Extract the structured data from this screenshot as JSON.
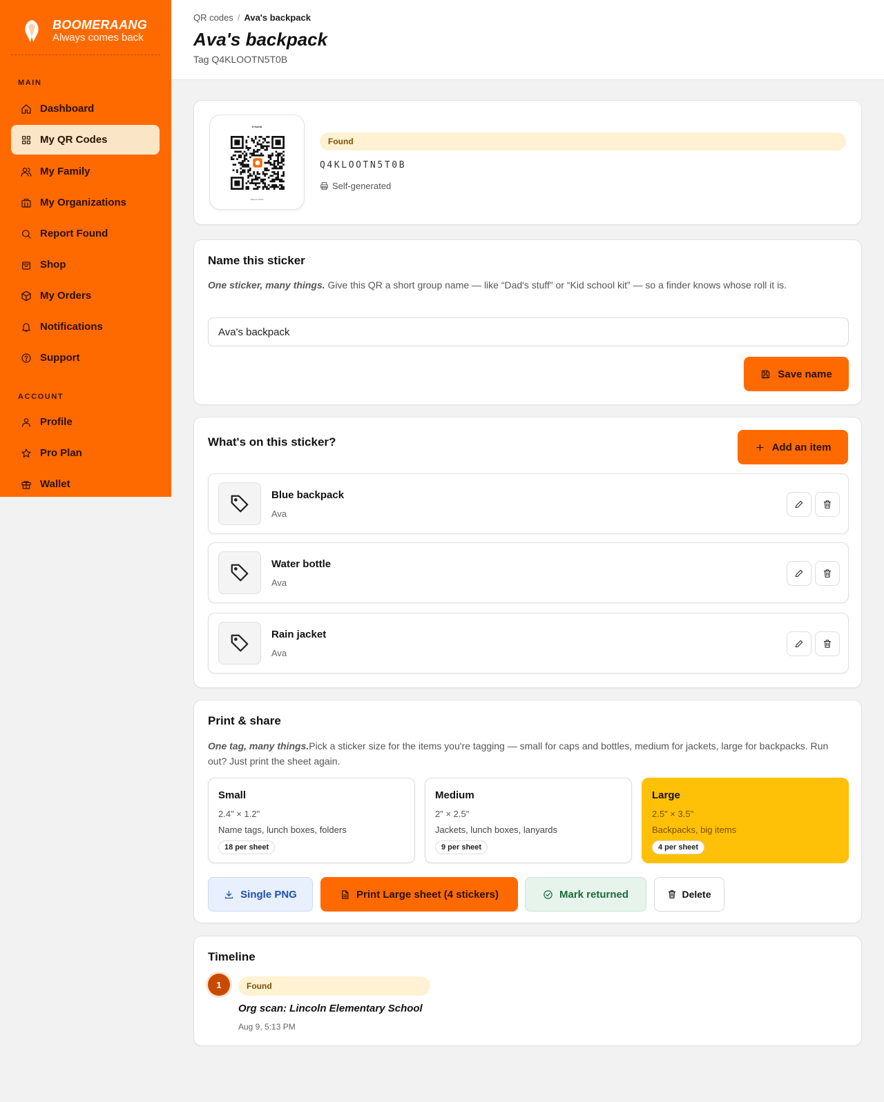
{
  "brand": {
    "name": "BOOMERAANG",
    "tagline": "Always comes back"
  },
  "sidebar": {
    "section_main": "MAIN",
    "section_account": "ACCOUNT",
    "main_items": [
      {
        "label": "Dashboard",
        "icon": "home-icon"
      },
      {
        "label": "My QR Codes",
        "icon": "grid-icon",
        "active": true
      },
      {
        "label": "My Family",
        "icon": "users-icon"
      },
      {
        "label": "My Organizations",
        "icon": "building-icon"
      },
      {
        "label": "Report Found",
        "icon": "search-icon"
      },
      {
        "label": "Shop",
        "icon": "shopping-bag-icon"
      },
      {
        "label": "My Orders",
        "icon": "package-icon"
      },
      {
        "label": "Notifications",
        "icon": "bell-icon"
      },
      {
        "label": "Support",
        "icon": "help-circle-icon"
      }
    ],
    "account_items": [
      {
        "label": "Profile",
        "icon": "user-icon"
      },
      {
        "label": "Pro Plan",
        "icon": "star-icon"
      },
      {
        "label": "Wallet",
        "icon": "gift-icon"
      }
    ]
  },
  "header": {
    "breadcrumb_root": "QR codes",
    "breadcrumb_sep": "/",
    "breadcrumb_current": "Ava's backpack",
    "title": "Ava's backpack",
    "subtitle": "Tag Q4KLOOTN5T0B"
  },
  "qr_card": {
    "thumb_top": "If found",
    "thumb_bottom": "Scan to return",
    "status": "Found",
    "code": "Q4KLOOTN5T0B",
    "source": "Self-generated"
  },
  "name_card": {
    "title": "Name this sticker",
    "desc_lead": "One sticker, many things.",
    "desc_rest": " Give this QR a short group name — like “Dad's stuff” or “Kid school kit” — so a finder knows whose roll it is.",
    "input_value": "Ava's backpack",
    "save_label": "Save name"
  },
  "items_card": {
    "title": "What's on this sticker?",
    "add_label": "Add an item",
    "items": [
      {
        "name": "Blue backpack",
        "owner": "Ava"
      },
      {
        "name": "Water bottle",
        "owner": "Ava"
      },
      {
        "name": "Rain jacket",
        "owner": "Ava"
      }
    ]
  },
  "print_card": {
    "title": "Print & share",
    "desc_lead": "One tag, many things.",
    "desc_rest": "Pick a sticker size for the items you're tagging — small for caps and bottles, medium for jackets, large for backpacks. Run out? Just print the sheet again.",
    "sizes": [
      {
        "name": "Small",
        "dims": "2.4\" × 1.2\"",
        "use": "Name tags, lunch boxes, folders",
        "count": "18 per sheet",
        "selected": false
      },
      {
        "name": "Medium",
        "dims": "2\" × 2.5\"",
        "use": "Jackets, lunch boxes, lanyards",
        "count": "9 per sheet",
        "selected": false
      },
      {
        "name": "Large",
        "dims": "2.5\" × 3.5\"",
        "use": "Backpacks, big items",
        "count": "4 per sheet",
        "selected": true
      }
    ],
    "actions": {
      "png": "Single PNG",
      "print": "Print Large sheet (4 stickers)",
      "returned": "Mark returned",
      "delete": "Delete"
    }
  },
  "timeline": {
    "title": "Timeline",
    "events": [
      {
        "index": "1",
        "status": "Found",
        "text": "Org scan: Lincoln Elementary School",
        "time": "Aug 9, 5:13 PM"
      }
    ]
  },
  "colors": {
    "brand_orange": "#ff6a00",
    "selected_yellow": "#ffc107",
    "found_pill": "#fff2d2"
  }
}
